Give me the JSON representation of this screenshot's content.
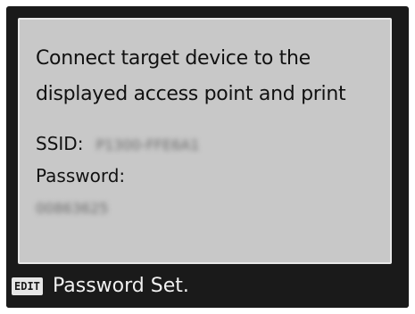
{
  "dialog": {
    "message": "Connect target device to the displayed access point and print",
    "ssid_label": "SSID:",
    "ssid_value": "P1300-FFE6A1",
    "password_label": "Password:",
    "password_value": "00863625"
  },
  "footer": {
    "edit_button_label": "EDIT",
    "hint_text": "Password Set."
  }
}
